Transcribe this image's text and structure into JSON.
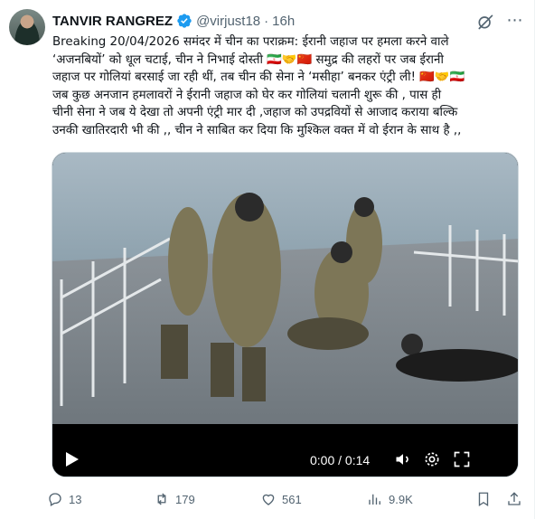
{
  "tweet": {
    "author_name": "TANVIR RANGREZ",
    "handle": "@virjust18",
    "separator": "·",
    "time": "16h",
    "lines": [
      "Breaking 20/04/2026 समंदर में चीन का पराक्रम: ईरानी जहाज पर हमला करने वाले",
      "‘अजनबियों’ को धूल चटाई, चीन ने निभाई दोस्ती 🇮🇷🤝🇨🇳 समुद्र की लहरों पर जब ईरानी",
      "जहाज पर गोलियां बरसाई जा रही थीं, तब चीन की सेना ने ‘मसीहा’ बनकर एंट्री ली! 🇨🇳🤝🇮🇷",
      "जब कुछ अनजान हमलावरों ने ईरानी जहाज को घेर कर गोलियां चलानी शुरू की , पास ही",
      "चीनी सेना ने जब ये देखा तो अपनी एंट्री मार दी ,जहाज को उपद्रवियों से आजाद कराया बल्कि",
      "उनकी खातिरदारी भी की ,, चीन ने साबित कर दिया कि मुश्किल वक्त में वो ईरान के साथ है ,,"
    ]
  },
  "video": {
    "timecode": "0:00 / 0:14",
    "icons": [
      "play-icon",
      "volume-icon",
      "settings-icon",
      "fullscreen-icon"
    ]
  },
  "actions": {
    "replies": "13",
    "reposts": "179",
    "likes": "561",
    "views": "9.9K"
  },
  "colors": {
    "text": "#0f1419",
    "secondary": "#536471",
    "verified": "#1d9bf0"
  }
}
